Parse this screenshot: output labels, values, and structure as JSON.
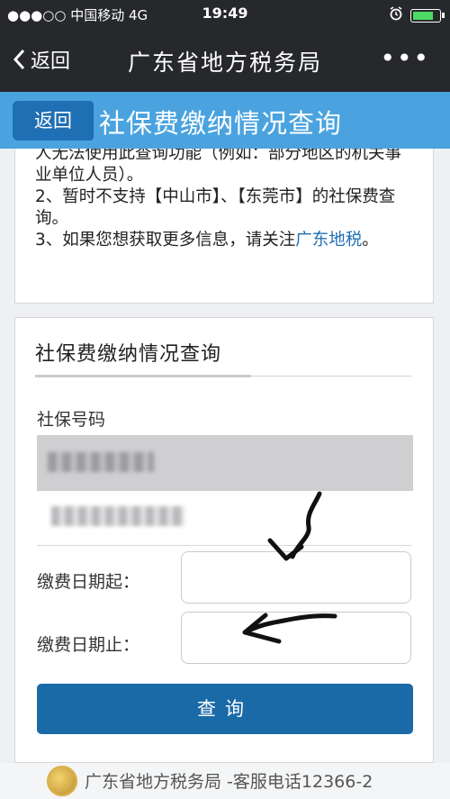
{
  "status_bar": {
    "carrier": "●●●○○ 中国移动 4G",
    "time": "19:49"
  },
  "nav": {
    "back_label": "返回",
    "title": "广东省地方税务局",
    "more_label": "•••"
  },
  "page_header": {
    "back_label": "返回",
    "title": "社保费缴纳情况查询"
  },
  "notice": {
    "line0": "人无法使用此查询功能（例如：部分地区的机关事业单位人员）。",
    "line2": "2、暂时不支持【中山市】、【东莞市】的社保费查询。",
    "line3_prefix": "3、如果您想获取更多信息，请关注",
    "line3_link": "广东地税",
    "line3_suffix": "。"
  },
  "form": {
    "title": "社保费缴纳情况查询",
    "ss_number_label": "社保号码",
    "start_date_label": "缴费日期起：",
    "end_date_label": "缴费日期止：",
    "submit_label": "查询"
  },
  "footer": {
    "text": "广东省地方税务局 -客服电话12366-2"
  }
}
